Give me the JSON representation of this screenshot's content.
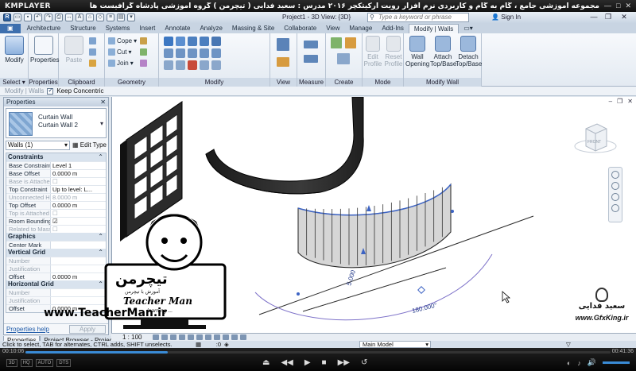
{
  "player": {
    "logo": "KMPLAYER",
    "caption": "مجموعه آموزشی جامع ، گام به گام و کاربردی نرم افزار رویت آرکیتکچر ۲۰۱۶  مدرس : سعید فدایی ( تیچرمن ) گروه آموزشی پادشاه گرافیست ها",
    "window_buttons": [
      "—",
      "□",
      "✕"
    ],
    "time_current": "00:10:06",
    "time_total": "00:41:36",
    "progress": 0.243,
    "left_badges": [
      "3D",
      "HQ",
      "AUTO",
      "DTS"
    ],
    "transport": [
      "⏏",
      "◀◀",
      "▶",
      "■",
      "▶▶",
      "↺"
    ],
    "right_icons": [
      "◐",
      "♪",
      "🔊"
    ]
  },
  "revit": {
    "document_title": "Project1 - 3D View: {3D}",
    "search_placeholder": "Type a keyword or phrase",
    "sign_in": "Sign In",
    "window_buttons": [
      "—",
      "❐",
      "✕"
    ],
    "tabs": [
      "Architecture",
      "Structure",
      "Systems",
      "Insert",
      "Annotate",
      "Analyze",
      "Massing & Site",
      "Collaborate",
      "View",
      "Manage",
      "Add-Ins",
      "Modify | Walls"
    ],
    "file_tab": "R",
    "ribbon": {
      "select": {
        "modify": "Modify",
        "label": "Select ▾"
      },
      "properties": {
        "button": "Properties",
        "label": "Properties"
      },
      "clipboard": {
        "paste": "Paste",
        "label": "Clipboard"
      },
      "geometry": {
        "cope": "Cope",
        "cut": "Cut",
        "join": "Join",
        "label": "Geometry"
      },
      "modify": {
        "label": "Modify"
      },
      "view": {
        "label": "View"
      },
      "measure": {
        "label": "Measure"
      },
      "create": {
        "label": "Create"
      },
      "mode": {
        "edit_profile": "Edit Profile",
        "reset_profile": "Reset Profile",
        "label": "Mode"
      },
      "modify_wall": {
        "wall_opening": "Wall Opening",
        "attach": "Attach Top/Base",
        "detach": "Detach Top/Base",
        "label": "Modify Wall"
      }
    },
    "options_bar": {
      "context": "Modify | Walls",
      "keep_concentric": "Keep Concentric"
    },
    "properties": {
      "title": "Properties",
      "type_family": "Curtain Wall",
      "type_name": "Curtain Wall 2",
      "instance_filter": "Walls (1)",
      "edit_type": "Edit Type",
      "groups": [
        {
          "name": "Constraints",
          "rows": [
            {
              "k": "Base Constraint",
              "v": "Level 1"
            },
            {
              "k": "Base Offset",
              "v": "0.0000 m"
            },
            {
              "k": "Base is Attached",
              "v": "☐",
              "muted": true
            },
            {
              "k": "Top Constraint",
              "v": "Up to level: L..."
            },
            {
              "k": "Unconnected H...",
              "v": "8.0000 m",
              "muted": true
            },
            {
              "k": "Top Offset",
              "v": "0.0000 m"
            },
            {
              "k": "Top is Attached",
              "v": "☐",
              "muted": true
            },
            {
              "k": "Room Bounding",
              "v": "☑"
            },
            {
              "k": "Related to Mass",
              "v": "☐",
              "muted": true
            }
          ]
        },
        {
          "name": "Graphics",
          "rows": [
            {
              "k": "Center Mark",
              "v": ""
            }
          ]
        },
        {
          "name": "Vertical Grid",
          "rows": [
            {
              "k": "Number",
              "v": "",
              "muted": true
            },
            {
              "k": "Justification",
              "v": "",
              "muted": true
            },
            {
              "k": "Offset",
              "v": "0.0000 m"
            }
          ]
        },
        {
          "name": "Horizontal Grid",
          "rows": [
            {
              "k": "Number",
              "v": "",
              "muted": true
            },
            {
              "k": "Justification",
              "v": "",
              "muted": true
            },
            {
              "k": "Offset",
              "v": "0.0000 m"
            }
          ]
        }
      ],
      "help": "Properties help",
      "apply": "Apply",
      "tab_properties": "Properties",
      "tab_browser": "Project Browser - Project1"
    },
    "viewport": {
      "angle_label": "180.000°",
      "radius_label": "5.000",
      "viewcube_label": "FRONT",
      "watermark_left": "www.TeacherMan.ir",
      "watermark_brand_fa": "تیچرمن",
      "watermark_brand_sub": "آموزش با تیچرمن",
      "watermark_brand_en": "Teacher Man",
      "watermark_brand_en2": "learning ... ",
      "watermark_right_fa": "سعید فدایی",
      "watermark_right_url": "www.GfxKing.ir"
    },
    "view_control": {
      "scale": "1 : 100"
    },
    "status": {
      "message": "Click to select, TAB for alternates, CTRL adds, SHIFT unselects.",
      "zero": ":0",
      "model": "Main Model"
    }
  }
}
